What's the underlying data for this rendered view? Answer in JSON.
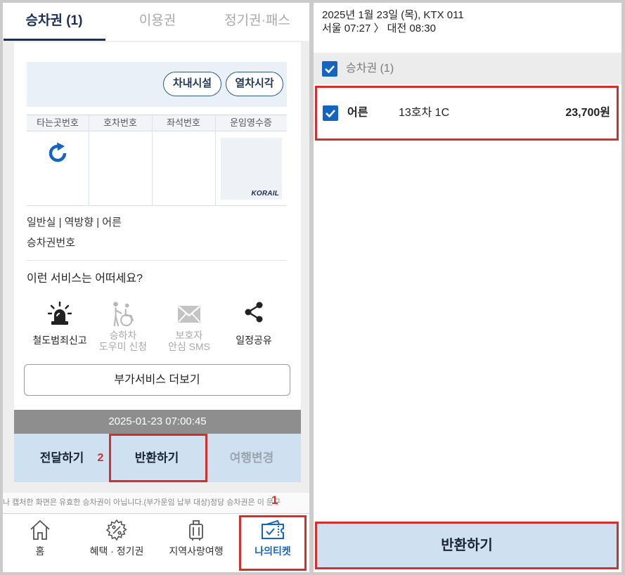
{
  "left": {
    "tabs": [
      {
        "label": "승차권 (1)",
        "active": true
      },
      {
        "label": "이용권",
        "active": false
      },
      {
        "label": "정기권·패스",
        "active": false
      }
    ],
    "ticket": {
      "buttons": {
        "facilities": "차내시설",
        "timetable": "열차시각"
      },
      "table_headers": [
        "타는곳번호",
        "호차번호",
        "좌석번호",
        "운임영수증"
      ],
      "refresh_icon": "refresh-icon",
      "receipt_logo": "KORAIL",
      "info_line": "일반실 | 역방향 | 어른",
      "ticket_number_label": "승차권번호"
    },
    "services": {
      "title": "이런 서비스는 어떠세요?",
      "items": [
        {
          "icon": "siren-icon",
          "label_lines": [
            "철도범죄신고"
          ],
          "enabled": true
        },
        {
          "icon": "wheelchair-helper-icon",
          "label_lines": [
            "승하차",
            "도우미 신청"
          ],
          "enabled": false
        },
        {
          "icon": "envelope-icon",
          "label_lines": [
            "보호자",
            "안심 SMS"
          ],
          "enabled": false
        },
        {
          "icon": "share-icon",
          "label_lines": [
            "일정공유"
          ],
          "enabled": true
        }
      ],
      "more_button": "부가서비스 더보기"
    },
    "timestamp": "2025-01-23 07:00:45",
    "actions": {
      "transfer": "전달하기",
      "refund": "반환하기",
      "change": "여행변경",
      "change_enabled": false
    },
    "notice": "나 캡처한 화면은 유효한 승차권이 아닙니다.(부가운임 납부 대상)정당 승차권은 이 문구",
    "bottom_nav": [
      {
        "icon": "home-icon",
        "label": "홈",
        "active": false
      },
      {
        "icon": "benefit-gear-icon",
        "label": "혜택 · 정기권",
        "active": false
      },
      {
        "icon": "luggage-icon",
        "label": "지역사랑여행",
        "active": false
      },
      {
        "icon": "ticket-check-icon",
        "label": "나의티켓",
        "active": true
      }
    ]
  },
  "annotations": {
    "step1": "1",
    "step2": "2"
  },
  "right": {
    "journey_line1": "2025년 1월 23일 (목), KTX 011",
    "journey_line2": "서울 07:27 〉 대전 08:30",
    "group": {
      "label": "승차권 (1)",
      "checked": true
    },
    "passengers": [
      {
        "type": "어른",
        "seat": "13호차 1C",
        "fare": "23,700원",
        "checked": true
      }
    ],
    "refund_button": "반환하기"
  },
  "colors": {
    "brand_navy": "#1b2f57",
    "accent_blue": "#1565c0",
    "annotation_red": "#d32f2f",
    "action_bar": "#cfe0f0",
    "timestamp_bar": "#8e8e8e"
  }
}
